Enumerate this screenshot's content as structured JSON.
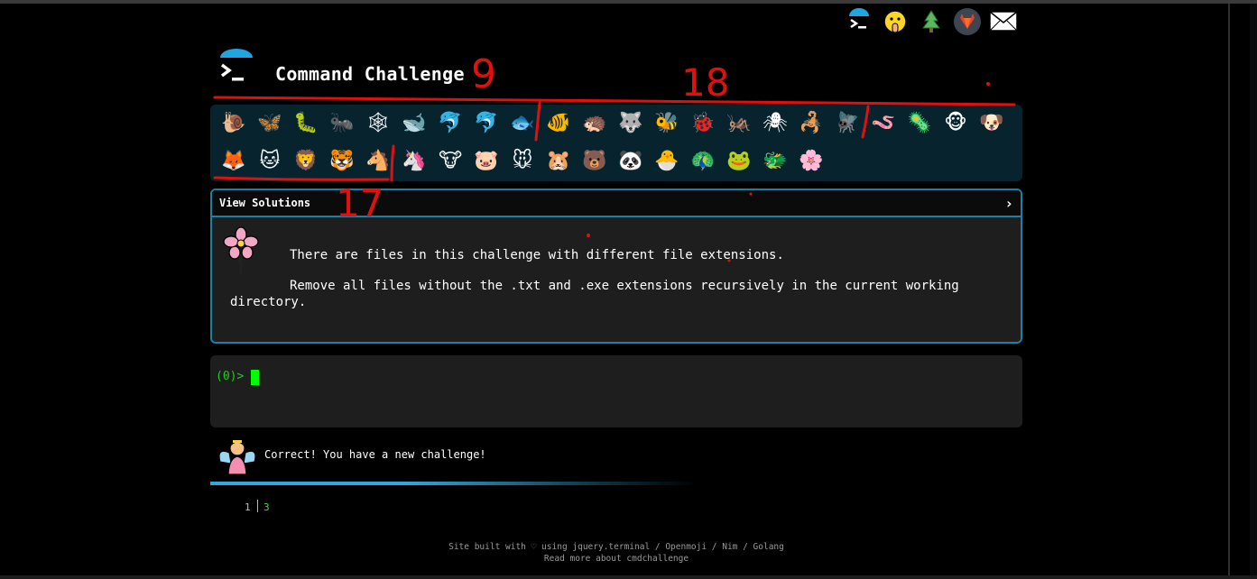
{
  "header": {
    "title": "Command Challenge",
    "top_icons": [
      "terminal-logo-icon",
      "shushing-face-icon",
      "tree-icon",
      "gitlab-icon",
      "envelope-icon"
    ]
  },
  "emoji_rows": [
    [
      "🐌",
      "🦋",
      "🐛",
      "🐜",
      "🕸",
      "🐋",
      "🐬",
      "🐬",
      "🐟",
      "🐠",
      "🦔",
      "🐺",
      "🐝",
      "🐞",
      "🦗",
      "🕷",
      "🦂",
      "🪰",
      "🪱",
      "🦠",
      "🐵",
      "🐶"
    ],
    [
      "🦊",
      "🐱",
      "🦁",
      "🐯",
      "🐴",
      "🦄",
      "🐮",
      "🐷",
      "🐭",
      "🐹",
      "🐻",
      "🐼",
      "🐣",
      "🦚",
      "🐸",
      "🐲",
      "🌸"
    ]
  ],
  "solutions": {
    "label": "View Solutions",
    "chevron": "›",
    "line1": "There are files in this challenge with different file extensions.",
    "line2": "Remove all files without the .txt and .exe extensions recursively in the current working directory."
  },
  "terminal": {
    "prompt": "(0)>"
  },
  "status": {
    "message": "Correct! You have a new challenge!",
    "progress": 0.6
  },
  "level": {
    "index": "1",
    "value": "3"
  },
  "footer": {
    "line1": "Site built with ♡ using jquery.terminal / Openmoji / Nim / Golang",
    "line2": "Read more about cmdchallenge"
  },
  "annotations": {
    "n1": "9",
    "n2": "18",
    "n3": "17"
  },
  "colors": {
    "accent": "#1d7fa1",
    "prompt_green": "#22c922",
    "cursor_green": "#00ff00",
    "annotation_red": "#e01010"
  }
}
